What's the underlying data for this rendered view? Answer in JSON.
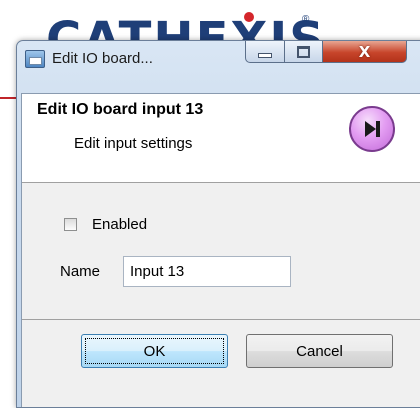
{
  "background": {
    "logo_text": "CATHEXIS",
    "logo_mark": "®"
  },
  "window": {
    "title": "Edit IO board...",
    "controls": {
      "minimize": "minimize",
      "maximize": "maximize",
      "close": "X"
    }
  },
  "header": {
    "title": "Edit IO board input 13",
    "subtitle": "Edit input settings",
    "next_icon": "skip-next-icon"
  },
  "form": {
    "enabled": {
      "label": "Enabled",
      "checked": false
    },
    "name": {
      "label": "Name",
      "value": "Input 13"
    }
  },
  "buttons": {
    "ok_label": "OK",
    "cancel_label": "Cancel"
  },
  "colors": {
    "logo": "#1f3f78",
    "accent_red": "#c0252a",
    "next_button": "#d98be9",
    "close_button": "#c7452b"
  }
}
